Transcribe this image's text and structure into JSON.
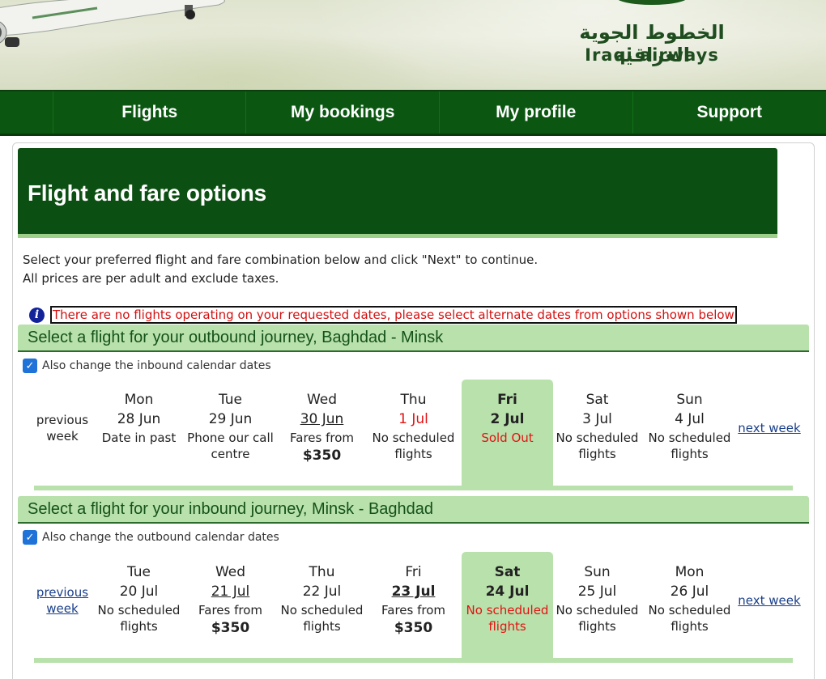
{
  "header": {
    "logo_arabic": "الخطوط الجوية العراقية",
    "logo_english": "Iraqi airways"
  },
  "nav": [
    "Flights",
    "My bookings",
    "My profile",
    "Support"
  ],
  "page": {
    "title": "Flight and fare options",
    "intro_line1": "Select your preferred flight and fare combination below and click \"Next\" to continue.",
    "intro_line2": "All prices are per adult and exclude taxes.",
    "notice": "There are no flights operating on your requested dates, please select alternate dates from options shown below"
  },
  "outbound": {
    "heading": "Select a flight for your outbound journey, Baghdad - Minsk",
    "checkbox_label": "Also change the inbound calendar dates",
    "prev_label": "previous week",
    "next_label": "next week",
    "days": [
      {
        "dow": "Mon",
        "date": "28 Jun",
        "note": "Date in past",
        "price": ""
      },
      {
        "dow": "Tue",
        "date": "29 Jun",
        "note": "Phone our call centre",
        "price": ""
      },
      {
        "dow": "Wed",
        "date": "30 Jun",
        "note": "Fares from",
        "price": "$350"
      },
      {
        "dow": "Thu",
        "date": "1 Jul",
        "note": "No scheduled flights",
        "price": ""
      },
      {
        "dow": "Fri",
        "date": "2 Jul",
        "note": "Sold Out",
        "price": ""
      },
      {
        "dow": "Sat",
        "date": "3 Jul",
        "note": "No scheduled flights",
        "price": ""
      },
      {
        "dow": "Sun",
        "date": "4 Jul",
        "note": "No scheduled flights",
        "price": ""
      }
    ]
  },
  "inbound": {
    "heading": "Select a flight for your inbound journey, Minsk - Baghdad",
    "checkbox_label": "Also change the outbound calendar dates",
    "prev_label": "previous week",
    "next_label": "next week",
    "days": [
      {
        "dow": "Tue",
        "date": "20 Jul",
        "note": "No scheduled flights",
        "price": ""
      },
      {
        "dow": "Wed",
        "date": "21 Jul",
        "note": "Fares from",
        "price": "$350"
      },
      {
        "dow": "Thu",
        "date": "22 Jul",
        "note": "No scheduled flights",
        "price": ""
      },
      {
        "dow": "Fri",
        "date": "23 Jul",
        "note": "Fares from",
        "price": "$350"
      },
      {
        "dow": "Sat",
        "date": "24 Jul",
        "note": "No scheduled flights",
        "price": ""
      },
      {
        "dow": "Sun",
        "date": "25 Jul",
        "note": "No scheduled flights",
        "price": ""
      },
      {
        "dow": "Mon",
        "date": "26 Jul",
        "note": "No scheduled flights",
        "price": ""
      }
    ]
  },
  "colors": {
    "nav_green": "#0b5711",
    "title_green": "#0c4f12",
    "light_green": "#b9e1ac",
    "alert_red": "#e31212"
  }
}
